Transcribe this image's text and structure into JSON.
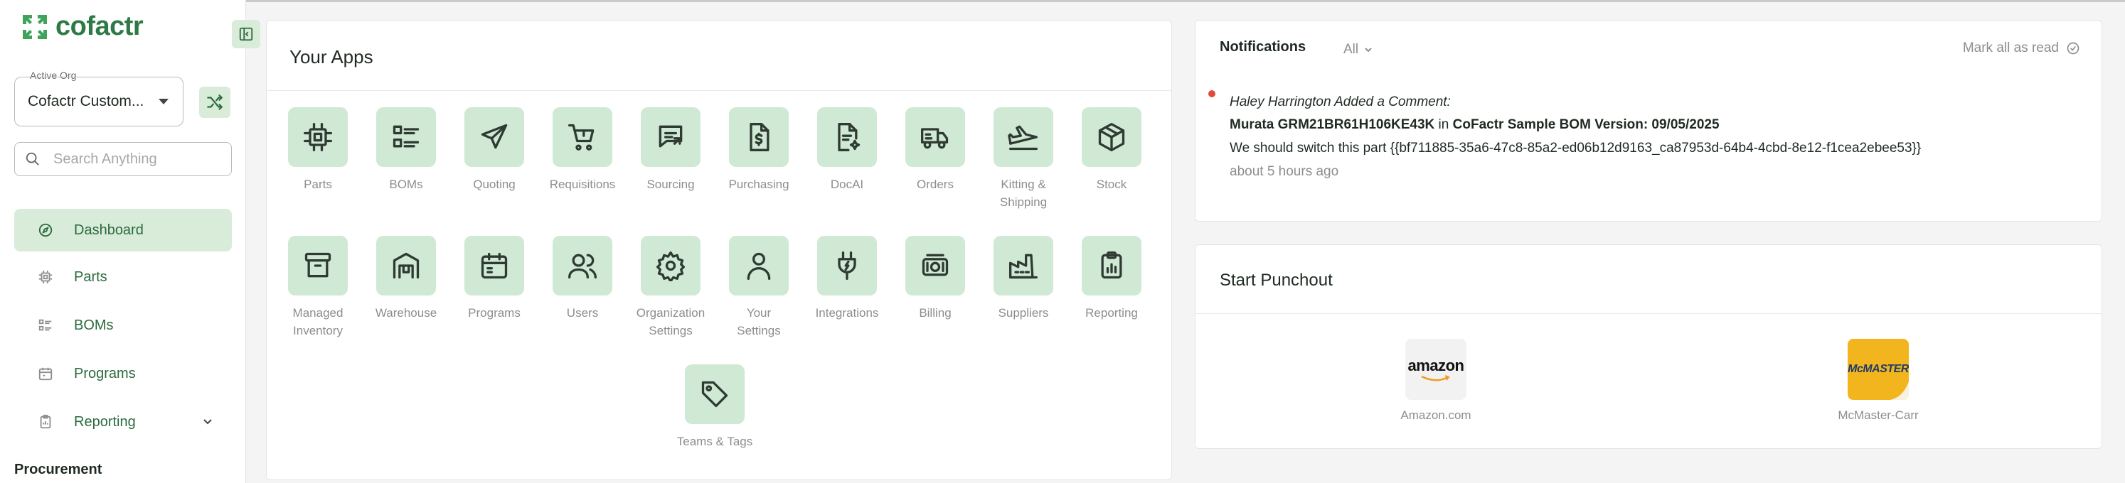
{
  "brand": {
    "name": "cofactr"
  },
  "org": {
    "label": "Active Org",
    "value": "Cofactr Custom..."
  },
  "search": {
    "placeholder": "Search Anything"
  },
  "nav": [
    {
      "label": "Dashboard",
      "icon": "compass-icon",
      "active": true
    },
    {
      "label": "Parts",
      "icon": "chip-icon"
    },
    {
      "label": "BOMs",
      "icon": "list-icon"
    },
    {
      "label": "Programs",
      "icon": "calendar-icon"
    },
    {
      "label": "Reporting",
      "icon": "clipboard-icon"
    }
  ],
  "sidebar_section": "Procurement",
  "apps": {
    "title": "Your Apps",
    "items": [
      {
        "label": "Parts",
        "icon": "chip-icon"
      },
      {
        "label": "BOMs",
        "icon": "list-icon"
      },
      {
        "label": "Quoting",
        "icon": "send-icon"
      },
      {
        "label": "Requisitions",
        "icon": "cart-icon"
      },
      {
        "label": "Sourcing",
        "icon": "message-icon"
      },
      {
        "label": "Purchasing",
        "icon": "dollar-file-icon"
      },
      {
        "label": "DocAI",
        "icon": "doc-ai-icon"
      },
      {
        "label": "Orders",
        "icon": "truck-icon"
      },
      {
        "label": "Kitting &\nShipping",
        "icon": "plane-icon"
      },
      {
        "label": "Stock",
        "icon": "box-icon"
      },
      {
        "label": "Managed\nInventory",
        "icon": "archive-icon"
      },
      {
        "label": "Warehouse",
        "icon": "warehouse-icon"
      },
      {
        "label": "Programs",
        "icon": "calendar-icon"
      },
      {
        "label": "Users",
        "icon": "users-icon"
      },
      {
        "label": "Organization\nSettings",
        "icon": "gear-icon"
      },
      {
        "label": "Your\nSettings",
        "icon": "user-icon"
      },
      {
        "label": "Integrations",
        "icon": "plug-icon"
      },
      {
        "label": "Billing",
        "icon": "money-icon"
      },
      {
        "label": "Suppliers",
        "icon": "factory-icon"
      },
      {
        "label": "Reporting",
        "icon": "clipboard-icon"
      },
      {
        "label": "Teams & Tags",
        "icon": "tag-icon"
      }
    ]
  },
  "notifications": {
    "title": "Notifications",
    "filter": "All",
    "mark_all": "Mark all as read",
    "item": {
      "author": "Haley Harrington Added a Comment:",
      "part": "Murata GRM21BR61H106KE43K",
      "in_text": " in ",
      "bom": "CoFactr Sample BOM Version: 09/05/2025",
      "message": "We should switch this part {{bf711885-35a6-47c8-85a2-ed06b12d9163_ca87953d-64b4-4cbd-8e12-f1cea2ebee53}}",
      "time": "about 5 hours ago"
    }
  },
  "punchout": {
    "title": "Start Punchout",
    "vendors": [
      {
        "name": "Amazon.com",
        "logo_text": "amazon"
      },
      {
        "name": "McMaster-Carr",
        "logo_text": "McMASTER"
      }
    ]
  },
  "colors": {
    "accent": "#2d7a45",
    "tile": "#cfe9d4",
    "active_nav": "#d8ecd9",
    "unread_dot": "#e04a3a"
  }
}
